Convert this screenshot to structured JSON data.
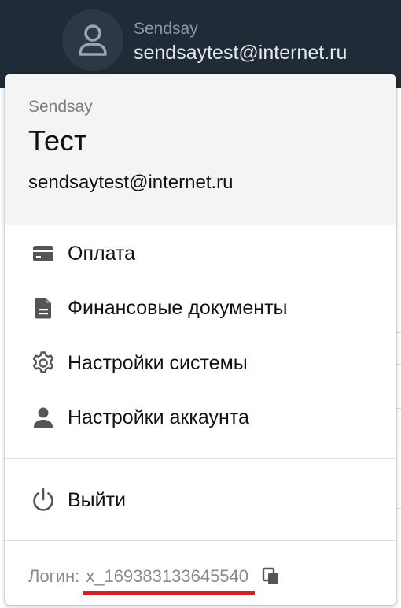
{
  "header": {
    "company": "Sendsay",
    "email": "sendsaytest@internet.ru"
  },
  "dropdown": {
    "company": "Sendsay",
    "account_name": "Тест",
    "email": "sendsaytest@internet.ru",
    "menu": [
      {
        "label": "Оплата",
        "icon": "credit-card-icon"
      },
      {
        "label": "Финансовые документы",
        "icon": "document-icon"
      },
      {
        "label": "Настройки системы",
        "icon": "gear-icon"
      },
      {
        "label": "Настройки аккаунта",
        "icon": "person-icon"
      }
    ],
    "logout": {
      "label": "Выйти",
      "icon": "power-icon"
    },
    "login": {
      "label": "Логин:",
      "value": "x_169383133645540",
      "copy_icon": "copy-icon"
    }
  },
  "colors": {
    "topbar": "#1f2b36",
    "panel_head": "#f4f4f4",
    "highlight_underline": "#e31a1c",
    "icon": "#555555"
  }
}
